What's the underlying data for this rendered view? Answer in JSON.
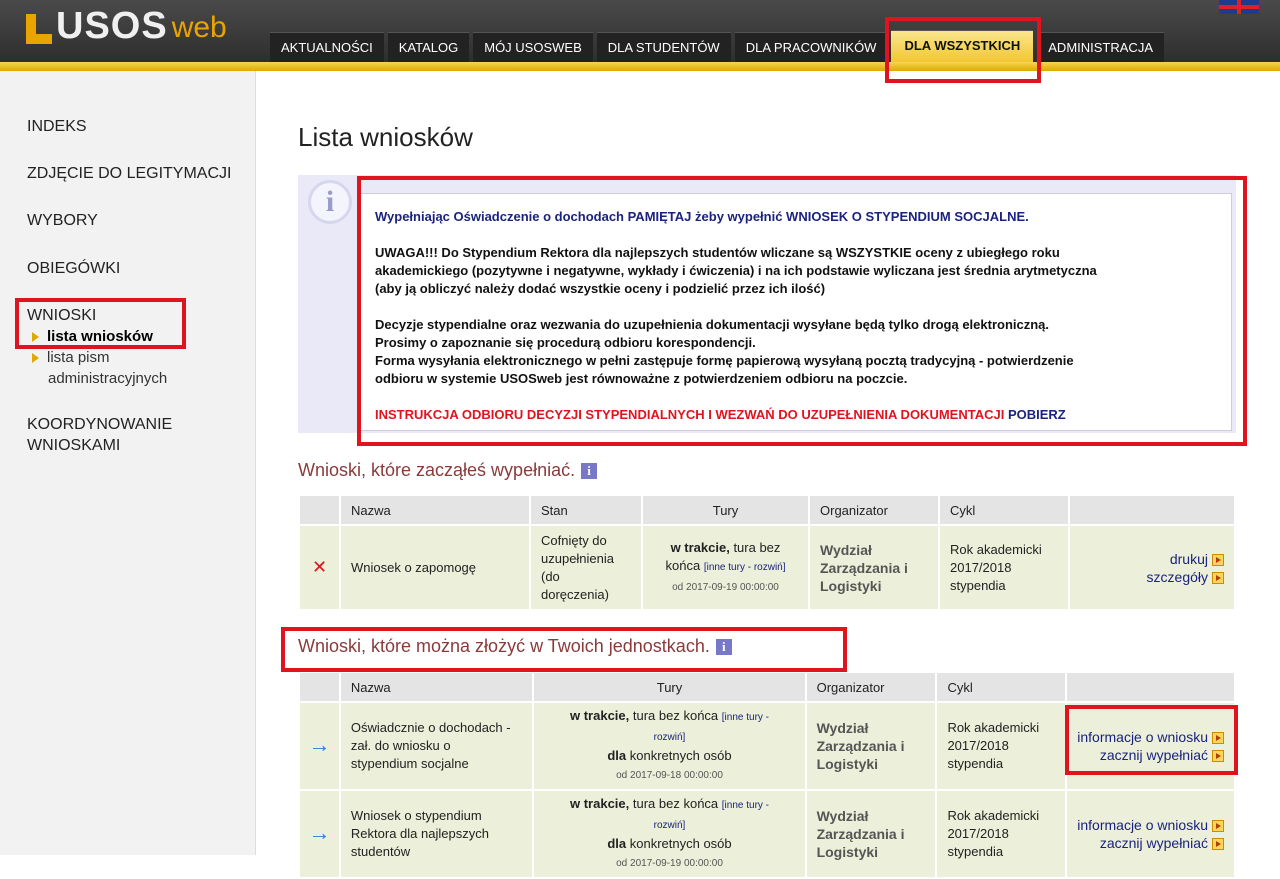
{
  "header": {
    "logo_main": "USOS",
    "logo_sub": "web",
    "tabs": [
      {
        "label": "AKTUALNOŚCI"
      },
      {
        "label": "KATALOG"
      },
      {
        "label": "MÓJ USOSWEB"
      },
      {
        "label": "DLA STUDENTÓW"
      },
      {
        "label": "DLA PRACOWNIKÓW"
      },
      {
        "label": "DLA WSZYSTKICH",
        "active": true
      },
      {
        "label": "ADMINISTRACJA"
      }
    ]
  },
  "sidebar": {
    "items": [
      {
        "label": "INDEKS"
      },
      {
        "label": "ZDJĘCIE DO LEGITYMACJI"
      },
      {
        "label": "WYBORY"
      },
      {
        "label": "OBIEGÓWKI"
      },
      {
        "label": "WNIOSKI"
      },
      {
        "label": "KOORDYNOWANIE"
      },
      {
        "label": "WNIOSKAMI"
      }
    ],
    "subitems": [
      {
        "label": "lista wniosków",
        "active": true
      },
      {
        "label": "lista pism"
      },
      {
        "label": "administracyjnych"
      }
    ]
  },
  "main": {
    "title": "Lista wniosków",
    "info": {
      "line1a": "Wypełniając Oświadczenie o dochodach PAMIĘTAJ żeby wypełnić WNIOSEK O STYPENDIUM SOCJALNE.",
      "p2_1": "UWAGA!!! Do Stypendium Rektora dla najlepszych studentów wliczane są WSZYSTKIE oceny z ubiegłego roku",
      "p2_2": "akademickiego (pozytywne i negatywne, wykłady i ćwiczenia) i na ich podstawie wyliczana jest średnia arytmetyczna",
      "p2_3": "(aby ją obliczyć należy dodać wszystkie oceny i podzielić przez ich ilość)",
      "p3_1": "Decyzje stypendialne oraz wezwania do uzupełnienia dokumentacji wysyłane będą tylko drogą elektroniczną.",
      "p3_2": "Prosimy o zapoznanie się procedurą odbioru korespondencji.",
      "p3_3": "Forma wysyłania elektronicznego w pełni zastępuje formę papierową wysyłaną pocztą tradycyjną - potwierdzenie",
      "p3_4": "odbioru w systemie USOSweb jest równoważne z potwierdzeniem odbioru na poczcie.",
      "instr": "INSTRUKCJA ODBIORU DECYZJI STYPENDIALNYCH I WEZWAŃ DO UZUPEŁNIENIA DOKUMENTACJI",
      "download": "POBIERZ"
    },
    "section1": {
      "title": "Wnioski, które zacząłeś wypełniać.",
      "headers": [
        "Nazwa",
        "Stan",
        "Tury",
        "Organizator",
        "Cykl"
      ],
      "row": {
        "name": "Wniosek o zapomogę",
        "state_1": "Cofnięty do",
        "state_2": "uzupełnienia",
        "state_3": "(do",
        "state_4": "doręczenia)",
        "tura_bold": "w trakcie,",
        "tura_rest": " tura bez",
        "tura_2": "końca",
        "tura_link": "[inne tury - rozwiń]",
        "tura_date": "od 2017-09-19 00:00:00",
        "org_1": "Wydział",
        "org_2": "Zarządzania i",
        "org_3": "Logistyki",
        "cycle_1": "Rok akademicki",
        "cycle_2": "2017/2018",
        "cycle_3": "stypendia",
        "action1": "drukuj",
        "action2": "szczegóły"
      }
    },
    "section2": {
      "title": "Wnioski, które można złożyć w Twoich jednostkach.",
      "headers": [
        "Nazwa",
        "Tury",
        "Organizator",
        "Cykl"
      ],
      "rows": [
        {
          "name_1": "Oświadcznie o dochodach -",
          "name_2": "zał. do wniosku o",
          "name_3": "stypendium socjalne",
          "tura_bold": "w trakcie,",
          "tura_rest": " tura bez końca ",
          "tura_link1": "[inne tury -",
          "tura_link2": "rozwiń]",
          "dla_bold": "dla",
          "dla_rest": " konkretnych osób",
          "tura_date": "od 2017-09-18 00:00:00",
          "org_1": "Wydział",
          "org_2": "Zarządzania i",
          "org_3": "Logistyki",
          "cycle_1": "Rok akademicki",
          "cycle_2": "2017/2018",
          "cycle_3": "stypendia",
          "action1": "informacje o wniosku",
          "action2": "zacznij wypełniać"
        },
        {
          "name_1": "Wniosek o stypendium",
          "name_2": "Rektora dla najlepszych",
          "name_3": "studentów",
          "tura_bold": "w trakcie,",
          "tura_rest": " tura bez końca ",
          "tura_link1": "[inne tury -",
          "tura_link2": "rozwiń]",
          "dla_bold": "dla",
          "dla_rest": " konkretnych osób",
          "tura_date": "od 2017-09-19 00:00:00",
          "org_1": "Wydział",
          "org_2": "Zarządzania i",
          "org_3": "Logistyki",
          "cycle_1": "Rok akademicki",
          "cycle_2": "2017/2018",
          "cycle_3": "stypendia",
          "action1": "informacje o wniosku",
          "action2": "zacznij wypełniać"
        }
      ]
    }
  },
  "colors": {
    "highlight": "#e0141e",
    "accent": "#f1c730",
    "section_title": "#8b3a3a",
    "link": "#1a237e"
  }
}
